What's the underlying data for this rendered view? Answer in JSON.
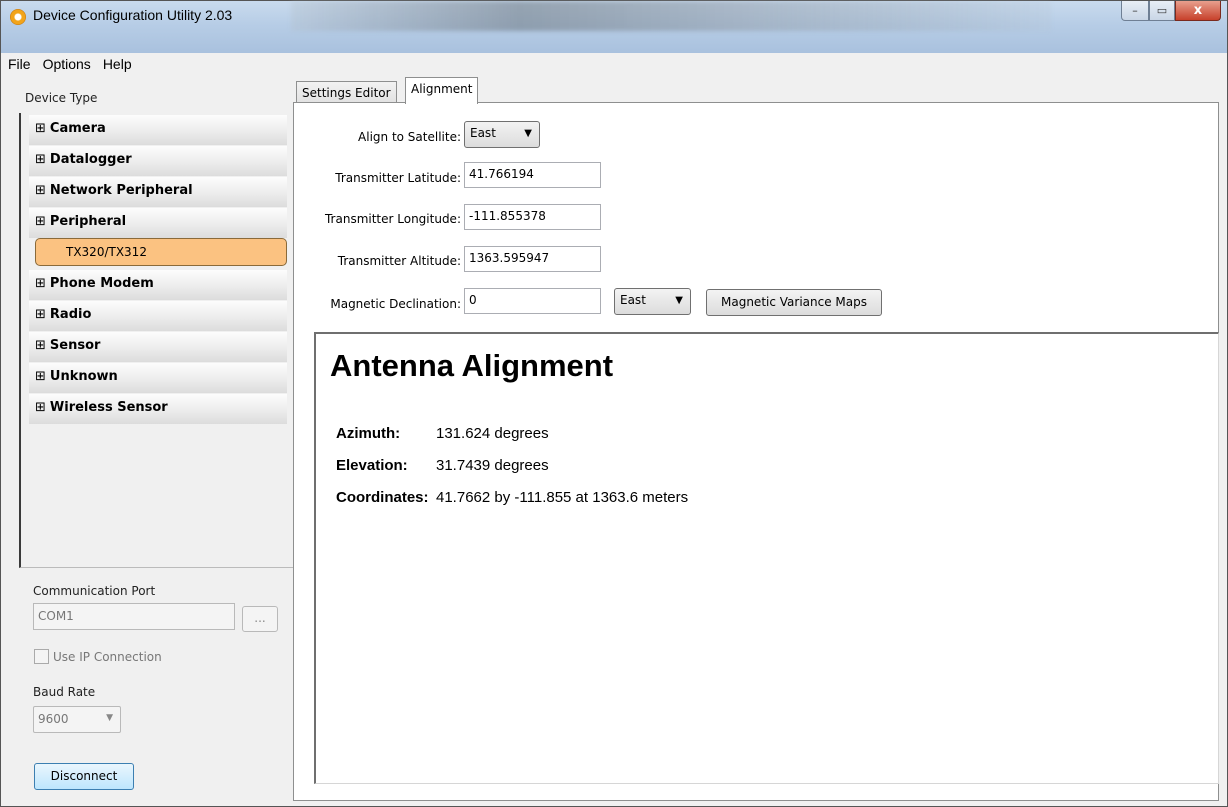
{
  "window": {
    "title": "Device Configuration Utility 2.03",
    "min_glyph": "–",
    "max_glyph": "▭",
    "close_glyph": "x"
  },
  "menu": {
    "file": "File",
    "options": "Options",
    "help": "Help"
  },
  "left": {
    "device_type_label": "Device Type",
    "expander_glyph": "⊞",
    "tree": [
      {
        "label": "Camera"
      },
      {
        "label": "Datalogger"
      },
      {
        "label": "Network Peripheral"
      },
      {
        "label": "Peripheral"
      },
      {
        "label": "TX320/TX312",
        "selected": true
      },
      {
        "label": "Phone Modem"
      },
      {
        "label": "Radio"
      },
      {
        "label": "Sensor"
      },
      {
        "label": "Unknown"
      },
      {
        "label": "Wireless Sensor"
      }
    ],
    "comm_port_label": "Communication Port",
    "comm_port_value": "COM1",
    "browse_label": "...",
    "use_ip_label": "Use IP Connection",
    "use_ip_checked": false,
    "baud_label": "Baud Rate",
    "baud_value": "9600",
    "disconnect_label": "Disconnect"
  },
  "tabs": [
    {
      "label": "Settings Editor",
      "active": false
    },
    {
      "label": "Alignment",
      "active": true
    }
  ],
  "form": {
    "align_label": "Align to Satellite:",
    "align_value": "East",
    "lat_label": "Transmitter Latitude:",
    "lat_value": "41.766194",
    "lon_label": "Transmitter Longitude:",
    "lon_value": "-111.855378",
    "alt_label": "Transmitter Altitude:",
    "alt_value": "1363.595947",
    "mag_label": "Magnetic Declination:",
    "mag_value": "0",
    "mag_dir_value": "East",
    "maps_button": "Magnetic Variance Maps"
  },
  "result": {
    "heading": "Antenna Alignment",
    "azimuth_label": "Azimuth:",
    "azimuth_value": "131.624 degrees",
    "elevation_label": "Elevation:",
    "elevation_value": "31.7439 degrees",
    "coords_label": "Coordinates:",
    "coords_value": "41.7662 by -111.855 at 1363.6 meters"
  },
  "colors": {
    "selected_item": "#fbc281",
    "disconnect_button": "#bee6fd",
    "title_bar": "#b7cde6"
  }
}
